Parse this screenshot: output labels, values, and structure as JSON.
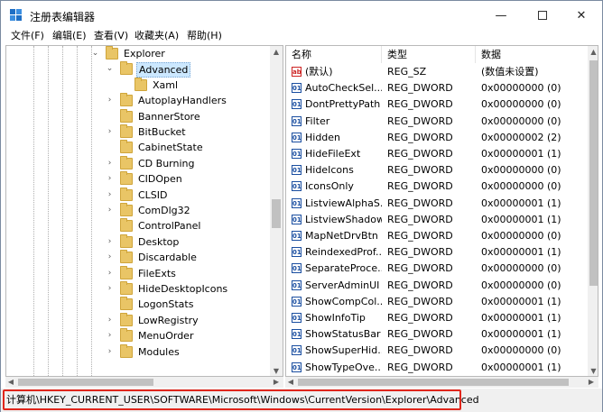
{
  "window": {
    "title": "注册表编辑器",
    "minimize_glyph": "—",
    "close_glyph": "✕"
  },
  "menu": [
    "文件(F)",
    "编辑(E)",
    "查看(V)",
    "收藏夹(A)",
    "帮助(H)"
  ],
  "tree": {
    "items": [
      {
        "label": "Explorer",
        "expander": "down"
      },
      {
        "label": "Advanced",
        "expander": "down",
        "selected": true
      },
      {
        "label": "Xaml",
        "expander": "none"
      },
      {
        "label": "AutoplayHandlers",
        "expander": "right"
      },
      {
        "label": "BannerStore",
        "expander": "none"
      },
      {
        "label": "BitBucket",
        "expander": "right"
      },
      {
        "label": "CabinetState",
        "expander": "none"
      },
      {
        "label": "CD Burning",
        "expander": "right"
      },
      {
        "label": "CIDOpen",
        "expander": "right"
      },
      {
        "label": "CLSID",
        "expander": "right"
      },
      {
        "label": "ComDlg32",
        "expander": "right"
      },
      {
        "label": "ControlPanel",
        "expander": "none"
      },
      {
        "label": "Desktop",
        "expander": "right"
      },
      {
        "label": "Discardable",
        "expander": "right"
      },
      {
        "label": "FileExts",
        "expander": "right"
      },
      {
        "label": "HideDesktopIcons",
        "expander": "right"
      },
      {
        "label": "LogonStats",
        "expander": "none"
      },
      {
        "label": "LowRegistry",
        "expander": "right"
      },
      {
        "label": "MenuOrder",
        "expander": "right"
      },
      {
        "label": "Modules",
        "expander": "right"
      }
    ]
  },
  "values_table": {
    "headers": [
      "名称",
      "类型",
      "数据"
    ],
    "rows": [
      {
        "icon": "ab",
        "name": "(默认)",
        "type": "REG_SZ",
        "data": "(数值未设置)"
      },
      {
        "icon": "dword",
        "name": "AutoCheckSel...",
        "type": "REG_DWORD",
        "data": "0x00000000 (0)"
      },
      {
        "icon": "dword",
        "name": "DontPrettyPath",
        "type": "REG_DWORD",
        "data": "0x00000000 (0)"
      },
      {
        "icon": "dword",
        "name": "Filter",
        "type": "REG_DWORD",
        "data": "0x00000000 (0)"
      },
      {
        "icon": "dword",
        "name": "Hidden",
        "type": "REG_DWORD",
        "data": "0x00000002 (2)"
      },
      {
        "icon": "dword",
        "name": "HideFileExt",
        "type": "REG_DWORD",
        "data": "0x00000001 (1)"
      },
      {
        "icon": "dword",
        "name": "HideIcons",
        "type": "REG_DWORD",
        "data": "0x00000000 (0)"
      },
      {
        "icon": "dword",
        "name": "IconsOnly",
        "type": "REG_DWORD",
        "data": "0x00000000 (0)"
      },
      {
        "icon": "dword",
        "name": "ListviewAlphaS...",
        "type": "REG_DWORD",
        "data": "0x00000001 (1)"
      },
      {
        "icon": "dword",
        "name": "ListviewShadow",
        "type": "REG_DWORD",
        "data": "0x00000001 (1)"
      },
      {
        "icon": "dword",
        "name": "MapNetDrvBtn",
        "type": "REG_DWORD",
        "data": "0x00000000 (0)"
      },
      {
        "icon": "dword",
        "name": "ReindexedProf...",
        "type": "REG_DWORD",
        "data": "0x00000001 (1)"
      },
      {
        "icon": "dword",
        "name": "SeparateProce...",
        "type": "REG_DWORD",
        "data": "0x00000000 (0)"
      },
      {
        "icon": "dword",
        "name": "ServerAdminUI",
        "type": "REG_DWORD",
        "data": "0x00000000 (0)"
      },
      {
        "icon": "dword",
        "name": "ShowCompCol...",
        "type": "REG_DWORD",
        "data": "0x00000001 (1)"
      },
      {
        "icon": "dword",
        "name": "ShowInfoTip",
        "type": "REG_DWORD",
        "data": "0x00000001 (1)"
      },
      {
        "icon": "dword",
        "name": "ShowStatusBar",
        "type": "REG_DWORD",
        "data": "0x00000001 (1)"
      },
      {
        "icon": "dword",
        "name": "ShowSuperHid...",
        "type": "REG_DWORD",
        "data": "0x00000000 (0)"
      },
      {
        "icon": "dword",
        "name": "ShowTypeOve...",
        "type": "REG_DWORD",
        "data": "0x00000001 (1)"
      }
    ]
  },
  "status_path": "计算机\\HKEY_CURRENT_USER\\SOFTWARE\\Microsoft\\Windows\\CurrentVersion\\Explorer\\Advanced",
  "colors": {
    "selection": "#cce8ff",
    "highlight_box": "#e0261c",
    "folder": "#e9c566"
  },
  "icons": {
    "app": "registry-editor-icon",
    "folder": "folder-icon",
    "string_value": "string-value-icon",
    "dword_value": "dword-value-icon"
  }
}
